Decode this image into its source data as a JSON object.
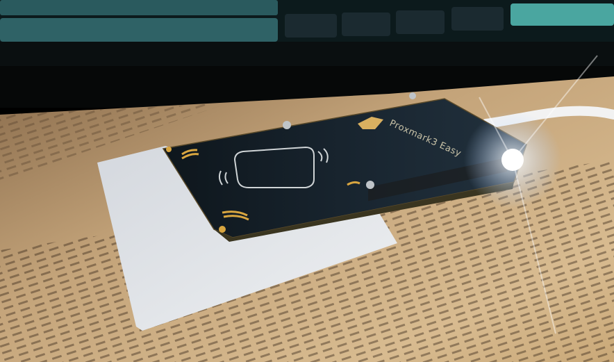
{
  "photo": {
    "board_label": "Proxmark3 Easy",
    "colors": {
      "mat": "#c9a878",
      "mat_ink": "#3a2a1c",
      "board": "#14202a",
      "card": "#dfe2e6",
      "keyboard": "#1f4a4e",
      "gold": "#d9a640",
      "led": "#ffffff"
    }
  }
}
